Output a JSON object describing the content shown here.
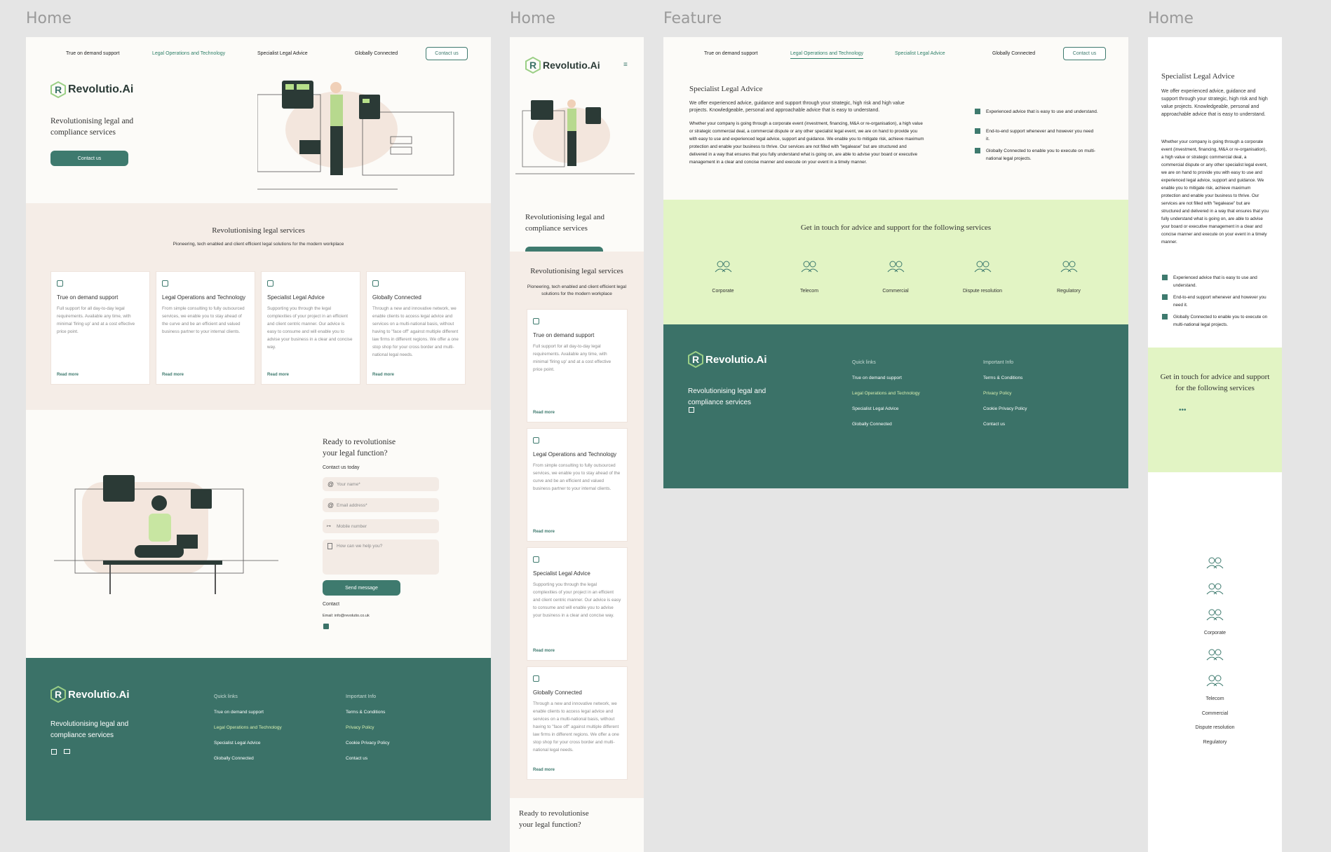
{
  "labels": {
    "home1": "Home",
    "home2": "Home",
    "feature": "Feature",
    "home3": "Home"
  },
  "nav": {
    "item1": "True on demand support",
    "item2": "Legal Operations and Technology",
    "item3": "Specialist Legal Advice",
    "item4": "Globally Connected",
    "contact": "Contact us"
  },
  "brand": {
    "name": "Revolutio.Ai",
    "tagline": "Revolutionising legal and compliance services",
    "tagline1": "Revolutionising legal and",
    "tagline2": "compliance services"
  },
  "hero": {
    "cta": "Contact us"
  },
  "services": {
    "title": "Revolutionising legal services",
    "subtitle": "Pioneering, tech enabled and client efficient legal solutions for the modern workplace",
    "subtitle_m1": "Pioneering, tech enabled and client efficient legal",
    "subtitle_m2": "solutions for the modern workplace",
    "read_more": "Read more",
    "cards": [
      {
        "title": "True on demand support",
        "desc": "Full support for all day-to-day legal requirements. Available any time, with minimal 'firing up' and at a cost effective price point."
      },
      {
        "title": "Legal Operations and Technology",
        "desc": "From simple consulting to fully outsourced services, we enable you to stay ahead of the curve and be an efficient and valued business partner to your internal clients."
      },
      {
        "title": "Specialist Legal Advice",
        "desc": "Supporting you through the legal complexities of your project in an efficient and client centric manner. Our advice is easy to consume and will enable you to advise your business in a clear and concise way."
      },
      {
        "title": "Globally Connected",
        "desc": "Through a new and innovative network, we enable clients to access legal advice and services on a multi-national basis, without having to \"face off\" against multiple different law firms in different regions. We offer a one stop shop for your cross border and multi-national legal needs."
      }
    ]
  },
  "contact_form": {
    "title1": "Ready to revolutionise",
    "title2": "your legal function?",
    "subtitle": "Contact us today",
    "name_ph": "Your name*",
    "email_ph": "Email address*",
    "mobile_ph": "Mobile number",
    "help_ph": "How can we help you?",
    "send": "Send message",
    "contact_label": "Contact",
    "email_line": "Email: info@revolutio.co.uk"
  },
  "footer": {
    "quick_links": "Quick links",
    "links": [
      "True on demand support",
      "Legal Operations and Technology",
      "Specialist Legal Advice",
      "Globally Connected"
    ],
    "important_info": "Important Info",
    "info": [
      "Terms & Conditions",
      "Privacy Policy",
      "Cookie Privacy Policy",
      "Contact us"
    ]
  },
  "feature": {
    "title": "Specialist Legal Advice",
    "intro": "We offer experienced advice, guidance and support through your strategic, high risk and high value projects. Knowledgeable, personal and approachable advice that is easy to understand.",
    "body": "Whether your company is going through a corporate event (investment, financing, M&A or re-organisation), a high value or strategic commercial deal, a commercial dispute or any other specialist legal event, we are on hand to provide you with easy to use and experienced legal advice, support and guidance. We enable you to mitigate risk, achieve maximum protection and enable your business to thrive. Our services are not filled with \"legalease\" but are structured and delivered in a way that ensures that you fully understand what is going on, are able to advise your board or executive management in a clear and concise manner and execute on your event in a timely manner.",
    "bullets": [
      "Experienced advice that is easy to use and understand.",
      "End-to-end support whenever and however you need it.",
      "Globally Connected to enable you to execute on multi-national legal projects."
    ],
    "band_title": "Get in touch for advice and support for the following services",
    "band_title_m1": "Get in touch for advice and support",
    "band_title_m2": "for the following services",
    "categories": [
      "Corporate",
      "Telecom",
      "Commercial",
      "Dispute resolution",
      "Regulatory"
    ]
  },
  "colors": {
    "teal": "#3b7268",
    "accent": "#2e7f68",
    "cream": "#f3ebe5",
    "lime": "#e2f4c4"
  }
}
